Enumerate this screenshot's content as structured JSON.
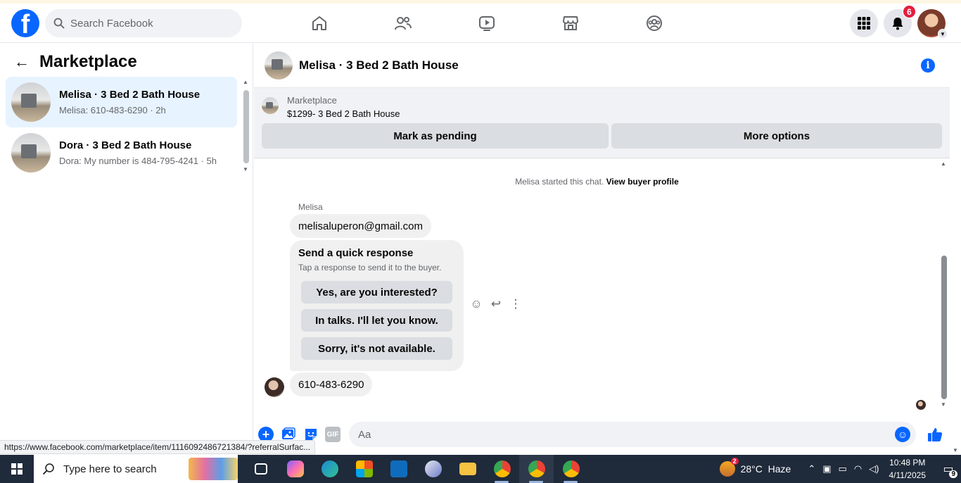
{
  "browser": {
    "status_url": "https://www.facebook.com/marketplace/item/1116092486721384/?referralSurfac..."
  },
  "topbar": {
    "logo_letter": "f",
    "search_placeholder": "Search Facebook",
    "nav_icons": [
      "home-icon",
      "friends-icon",
      "video-icon",
      "marketplace-icon",
      "groups-icon"
    ],
    "notification_count": "6"
  },
  "left": {
    "back_glyph": "←",
    "title": "Marketplace",
    "conversations": [
      {
        "name": "Melisa · 3 Bed 2 Bath House",
        "preview": "Melisa: 610-483-6290 · 2h",
        "active": true
      },
      {
        "name": "Dora · 3 Bed 2 Bath House",
        "preview": "Dora: My number is 484-795-4241 · 5h",
        "active": false
      }
    ]
  },
  "chat": {
    "title": "Melisa · 3 Bed 2 Bath House",
    "info_glyph": "i",
    "listing": {
      "label": "Marketplace",
      "price_title": "$1299- 3 Bed 2 Bath House",
      "mark_pending": "Mark as pending",
      "more_options": "More options"
    },
    "started_text": "Melisa started this chat.",
    "view_profile": "View buyer profile",
    "sender": "Melisa",
    "email_message": "melisaluperon@gmail.com",
    "quick_response": {
      "title": "Send a quick response",
      "subtitle": "Tap a response to send it to the buyer.",
      "options": [
        "Yes, are you interested?",
        "In talks. I'll let you know.",
        "Sorry, it's not available."
      ]
    },
    "phone_message": "610-483-6290",
    "composer": {
      "placeholder": "Aa",
      "plus_glyph": "+",
      "gif_label": "GIF"
    }
  },
  "taskbar": {
    "search_placeholder": "Type here to search",
    "temperature": "28°C",
    "weather": "Haze",
    "weather_badge": "2",
    "time": "10:48 PM",
    "date": "4/11/2025",
    "notification_count": "9",
    "app_colors": [
      "#3b3b3b",
      "#7b61ff",
      "#1a8ad4",
      "#f25022",
      "#0f6cbd",
      "#6b7cc9",
      "#f5c242",
      "#34a853",
      "#4285f4",
      "#0f9d58"
    ]
  },
  "colors": {
    "brand": "#0866ff",
    "badge": "#e41e3f",
    "active_item": "#e7f3ff"
  }
}
